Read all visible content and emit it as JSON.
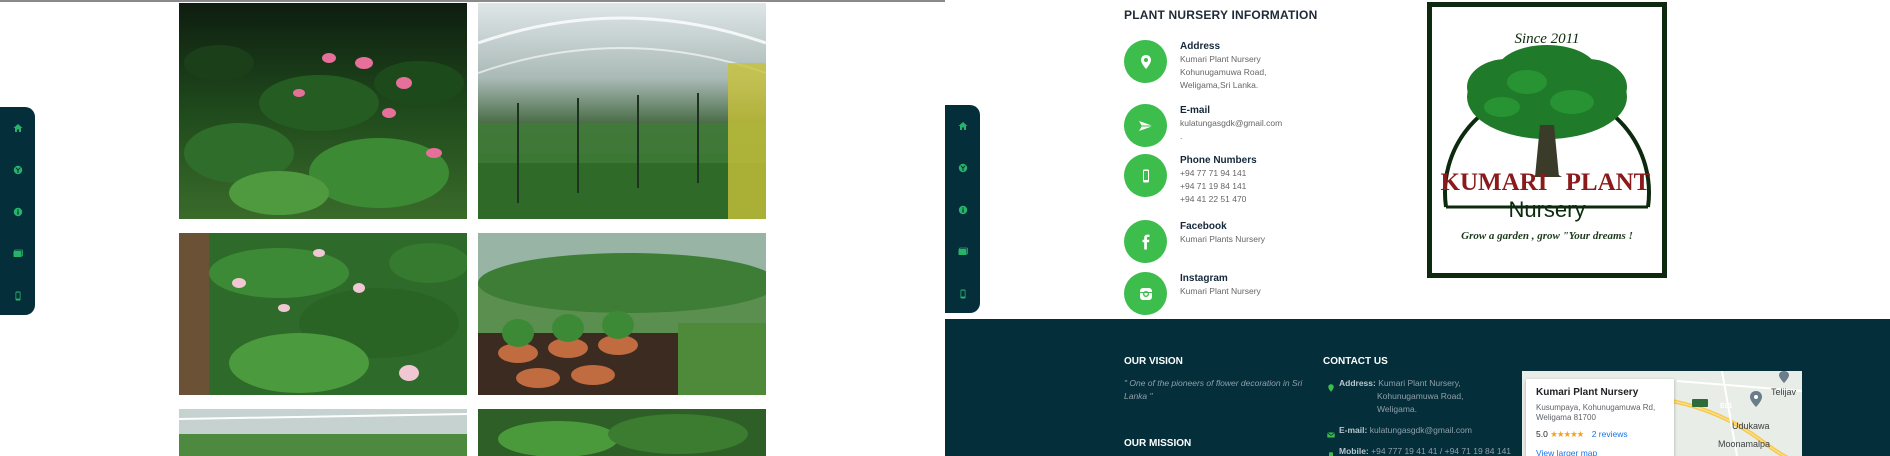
{
  "left_panel": {
    "nav_icons": [
      "home-icon",
      "sprout-icon",
      "info-icon",
      "gallery-icon",
      "phone-icon"
    ],
    "gallery_photos": [
      "anthurium-beds",
      "greenhouse-mist",
      "anthurium-rows",
      "potted-plants",
      "greenhouse-rows",
      "foliage-plants"
    ]
  },
  "right_panel": {
    "nav_icons": [
      "home-icon",
      "sprout-icon",
      "info-icon",
      "gallery-icon",
      "phone-icon"
    ],
    "info_title": "PLANT NURSERY INFORMATION",
    "address": {
      "heading": "Address",
      "lines": [
        "Kumari Plant Nursery",
        "Kohunugamuwa Road,",
        "Weligama,Sri Lanka."
      ],
      "icon": "location-pin-icon"
    },
    "email": {
      "heading": "E-mail",
      "lines": [
        "kulatungasgdk@gmail.com",
        "."
      ],
      "icon": "paper-plane-icon"
    },
    "phone": {
      "heading": "Phone Numbers",
      "lines": [
        "+94 77 71 94 141",
        "+94 71 19 84 141",
        "+94 41 22 51 470"
      ],
      "icon": "mobile-icon"
    },
    "facebook": {
      "heading": "Facebook",
      "lines": [
        "Kumari Plants Nursery"
      ],
      "icon": "facebook-icon"
    },
    "instagram": {
      "heading": "Instagram",
      "lines": [
        "Kumari Plant Nursery"
      ],
      "icon": "instagram-icon"
    },
    "logo": {
      "since": "Since 2011",
      "name_line1_a": "KUMARI",
      "name_line1_b": "PLANT",
      "name_line2": "Nursery",
      "tagline": "Grow a garden , grow \"Your dreams !"
    },
    "footer": {
      "vision_title": "OUR VISION",
      "vision_text_1": "\" One of the pioneers of flower decoration in Sri",
      "vision_text_2": "Lanka \"",
      "mission_title": "OUR MISSION",
      "contact_title": "CONTACT US",
      "address_label": "Address:",
      "address_lines": [
        "Kumari Plant Nursery,",
        "Kohunugamuwa Road,",
        "Weligama."
      ],
      "email_label": "E-mail:",
      "email_value": "kulatungasgdk@gmail.com",
      "mobile_label": "Mobile:",
      "mobile_value": "+94 777 19 41 41 / +94 71 19 84 141"
    },
    "map": {
      "place_name": "Kumari Plant Nursery",
      "address_1": "Kusumpaya, Kohunugamuwa Rd,",
      "address_2": "Weligama 81700",
      "rating": "5.0",
      "stars": "★★★★★",
      "reviews": "2 reviews",
      "larger_map": "View larger map",
      "places": [
        "Telijav",
        "Udukawa",
        "Moonamalpa"
      ],
      "road_tag": "E01"
    }
  },
  "colors": {
    "dark_navy": "#052e3b",
    "accent_green": "#3cbd4c",
    "logo_dark_green": "#0d2a0e",
    "logo_red": "#8b1a1a"
  }
}
